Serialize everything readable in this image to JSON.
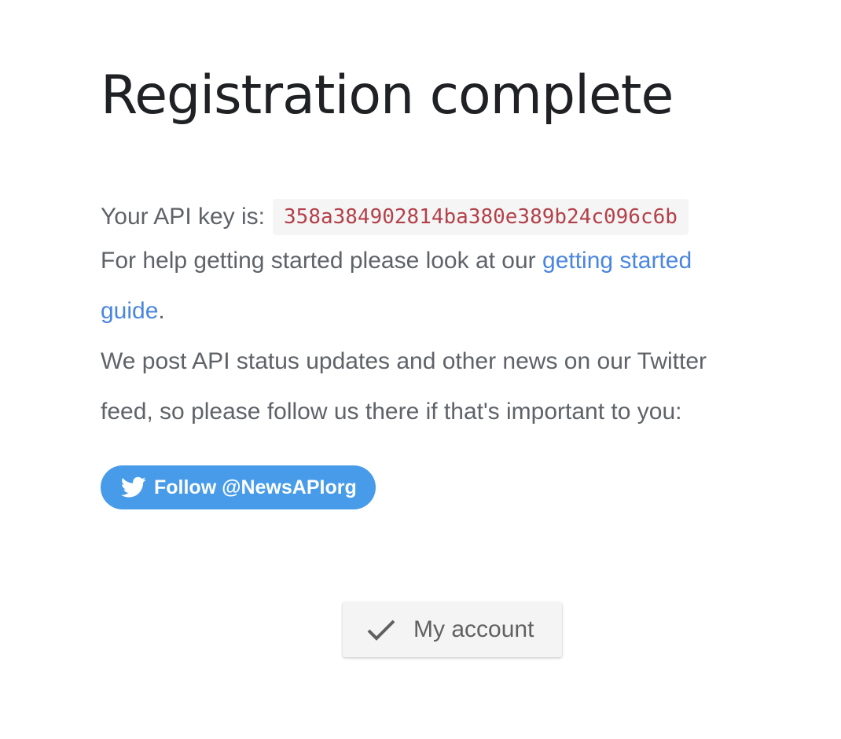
{
  "heading": "Registration complete",
  "api_key": {
    "label": "Your API key is:",
    "value": "358a384902814ba380e389b24c096c6b"
  },
  "help": {
    "text_before": "For help getting started please look at our ",
    "link_text": "getting started guide",
    "text_after": "."
  },
  "twitter_note": "We post API status updates and other news on our Twitter feed, so please follow us there if that's important to you:",
  "twitter_button": {
    "label": "Follow @NewsAPIorg",
    "icon": "twitter-bird-icon",
    "color": "#479be8"
  },
  "account_button": {
    "label": "My account",
    "icon": "checkmark-icon"
  },
  "colors": {
    "link": "#4a86e0",
    "code_text": "#b3414a",
    "heading": "#202124",
    "body_text": "#5f6368"
  }
}
